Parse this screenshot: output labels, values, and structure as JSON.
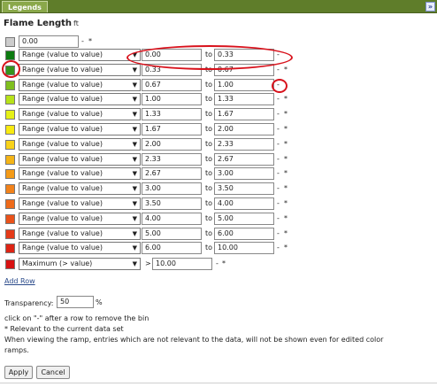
{
  "panel": {
    "tab_label": "Legends",
    "collapse_icon": "double-chevron-right-icon"
  },
  "legend": {
    "title": "Flame Length",
    "unit": "ft"
  },
  "first_row": {
    "color": "#cccccc",
    "value": "0.00",
    "remove": "-",
    "relevant": "*"
  },
  "rows": [
    {
      "color": "#0c7a10",
      "type": "Range (value to value)",
      "from": "0.00",
      "to_label": "to",
      "to": "0.33",
      "remove": "-",
      "relevant": ""
    },
    {
      "color": "#34941c",
      "type": "Range (value to value)",
      "from": "0.33",
      "to_label": "to",
      "to": "0.67",
      "remove": "-",
      "relevant": "*"
    },
    {
      "color": "#7fbf1e",
      "type": "Range (value to value)",
      "from": "0.67",
      "to_label": "to",
      "to": "1.00",
      "remove": "-",
      "relevant": ""
    },
    {
      "color": "#b7e219",
      "type": "Range (value to value)",
      "from": "1.00",
      "to_label": "to",
      "to": "1.33",
      "remove": "-",
      "relevant": "*"
    },
    {
      "color": "#e5f016",
      "type": "Range (value to value)",
      "from": "1.33",
      "to_label": "to",
      "to": "1.67",
      "remove": "-",
      "relevant": "*"
    },
    {
      "color": "#f8ea10",
      "type": "Range (value to value)",
      "from": "1.67",
      "to_label": "to",
      "to": "2.00",
      "remove": "-",
      "relevant": "*"
    },
    {
      "color": "#f8d21a",
      "type": "Range (value to value)",
      "from": "2.00",
      "to_label": "to",
      "to": "2.33",
      "remove": "-",
      "relevant": "*"
    },
    {
      "color": "#f4b416",
      "type": "Range (value to value)",
      "from": "2.33",
      "to_label": "to",
      "to": "2.67",
      "remove": "-",
      "relevant": "*"
    },
    {
      "color": "#f49a16",
      "type": "Range (value to value)",
      "from": "2.67",
      "to_label": "to",
      "to": "3.00",
      "remove": "-",
      "relevant": "*"
    },
    {
      "color": "#f2821a",
      "type": "Range (value to value)",
      "from": "3.00",
      "to_label": "to",
      "to": "3.50",
      "remove": "-",
      "relevant": "*"
    },
    {
      "color": "#ee6a1a",
      "type": "Range (value to value)",
      "from": "3.50",
      "to_label": "to",
      "to": "4.00",
      "remove": "-",
      "relevant": "*"
    },
    {
      "color": "#ea521a",
      "type": "Range (value to value)",
      "from": "4.00",
      "to_label": "to",
      "to": "5.00",
      "remove": "-",
      "relevant": "*"
    },
    {
      "color": "#e43a18",
      "type": "Range (value to value)",
      "from": "5.00",
      "to_label": "to",
      "to": "6.00",
      "remove": "-",
      "relevant": "*"
    },
    {
      "color": "#de2414",
      "type": "Range (value to value)",
      "from": "6.00",
      "to_label": "to",
      "to": "10.00",
      "remove": "-",
      "relevant": "*"
    }
  ],
  "max_row": {
    "color": "#d81212",
    "type": "Maximum (> value)",
    "gt": ">",
    "value": "10.00",
    "remove": "-",
    "relevant": "*"
  },
  "add_row": "Add Row",
  "transparency": {
    "label": "Transparency:",
    "value": "50",
    "unit": "%"
  },
  "notes": [
    "click on \"-\" after a row to remove the bin",
    "* Relevant to the current data set",
    "When viewing the ramp, entries which are not relevant to the data, will not be shown even for edited color",
    "ramps."
  ],
  "buttons": {
    "apply": "Apply",
    "cancel": "Cancel"
  },
  "annotation_color": "#d8121c"
}
